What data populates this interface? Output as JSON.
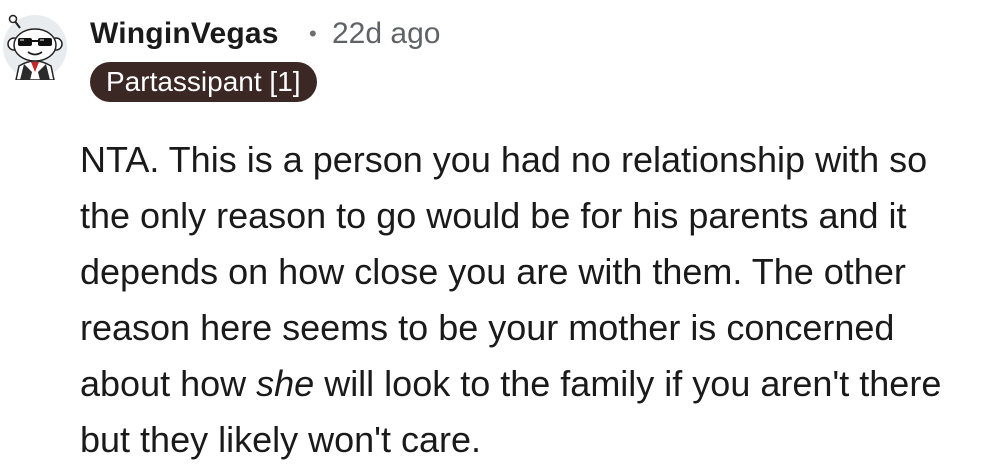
{
  "comment": {
    "author": "WinginVegas",
    "separator": "•",
    "time_ago": "22d ago",
    "flair": "Partassipant [1]",
    "avatar_icon": "snoo-avatar-icon",
    "body": {
      "part1": "NTA. This is a person you had no relationship with so the only reason to go would be for his parents and it depends on how close you are with them. The other reason here seems to be your mother is concerned about how ",
      "emphasis": "she",
      "part2": " will look to the family if you aren't there but they likely won't care."
    }
  },
  "colors": {
    "flair_bg": "#3b2723",
    "flair_text": "#ffffff",
    "text": "#1a1a1b",
    "muted": "#5f6368"
  }
}
